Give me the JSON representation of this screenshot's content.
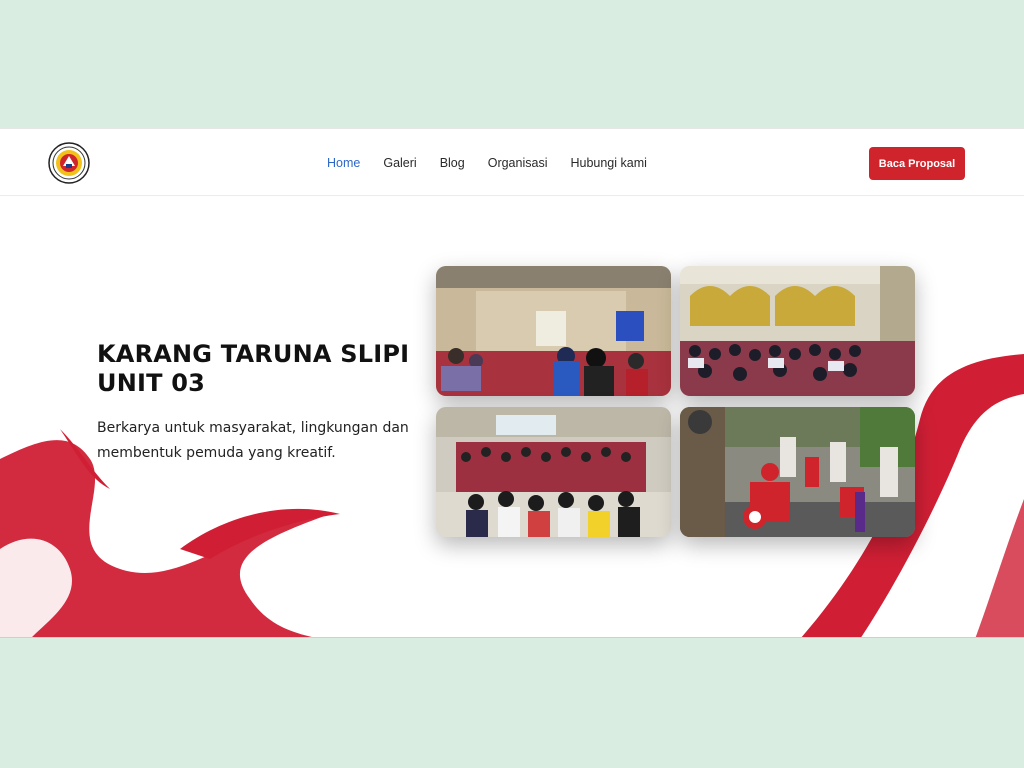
{
  "header": {
    "logo_icon": "karang-taruna-emblem",
    "nav": [
      {
        "label": "Home",
        "active": true
      },
      {
        "label": "Galeri",
        "active": false
      },
      {
        "label": "Blog",
        "active": false
      },
      {
        "label": "Organisasi",
        "active": false
      },
      {
        "label": "Hubungi kami",
        "active": false
      }
    ],
    "cta_label": "Baca Proposal"
  },
  "hero": {
    "title_line1": "KARANG TARUNA SLIPI",
    "title_line2": "UNIT 03",
    "subtitle_line1": "Berkarya untuk masyarakat, lingkungan dan",
    "subtitle_line2": "membentuk pemuda yang kreatif."
  },
  "gallery": {
    "photos": [
      "photo-hall-presentation",
      "photo-seated-audience",
      "photo-standing-group",
      "photo-street-parade"
    ]
  },
  "colors": {
    "accent": "#d0242d",
    "nav_active": "#2f67c9",
    "page_bg": "#d9ede0"
  }
}
